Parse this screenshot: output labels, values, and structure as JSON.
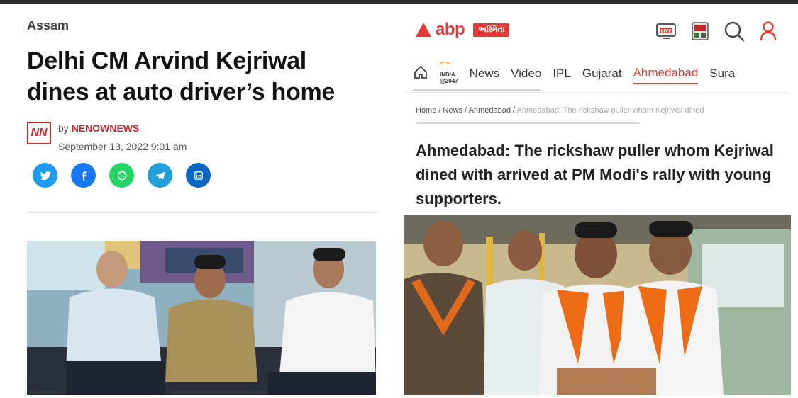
{
  "left_article": {
    "category": "Assam",
    "headline": "Delhi CM Arvind Kejriwal dines at auto driver’s home",
    "logo_text": "NN",
    "byline_prefix": "by",
    "source": "NENOWNEWS",
    "date": "September 13, 2022 9:01 am",
    "share_icons": [
      {
        "name": "twitter-icon",
        "color": "#1d9bf0"
      },
      {
        "name": "facebook-icon",
        "color": "#1877f2"
      },
      {
        "name": "whatsapp-icon",
        "color": "#25d366"
      },
      {
        "name": "telegram-icon",
        "color": "#229ed9"
      },
      {
        "name": "linkedin-icon",
        "color": "#0a66c2"
      }
    ]
  },
  "right_article": {
    "brand": "abp",
    "brand_tag": "અસ્મિતા",
    "brand_color": "#e53935",
    "top_icons": [
      "live-tv-icon",
      "epaper-icon",
      "search-icon",
      "user-icon"
    ],
    "live_label": "LIVE",
    "nav": {
      "india_badge_line1": "INDIA",
      "india_badge_line2": "@2047",
      "items": [
        "News",
        "Video",
        "IPL",
        "Gujarat",
        "Ahmedabad",
        "Sura"
      ]
    },
    "breadcrumb": {
      "home": "Home",
      "news": "News",
      "section": "Ahmedabad",
      "current": "Ahmedabad: The rickshaw puller whom Kejriwal dined"
    },
    "headline": "Ahmedabad: The rickshaw puller whom Kejriwal dined with arrived at PM Modi's rally with young supporters."
  }
}
